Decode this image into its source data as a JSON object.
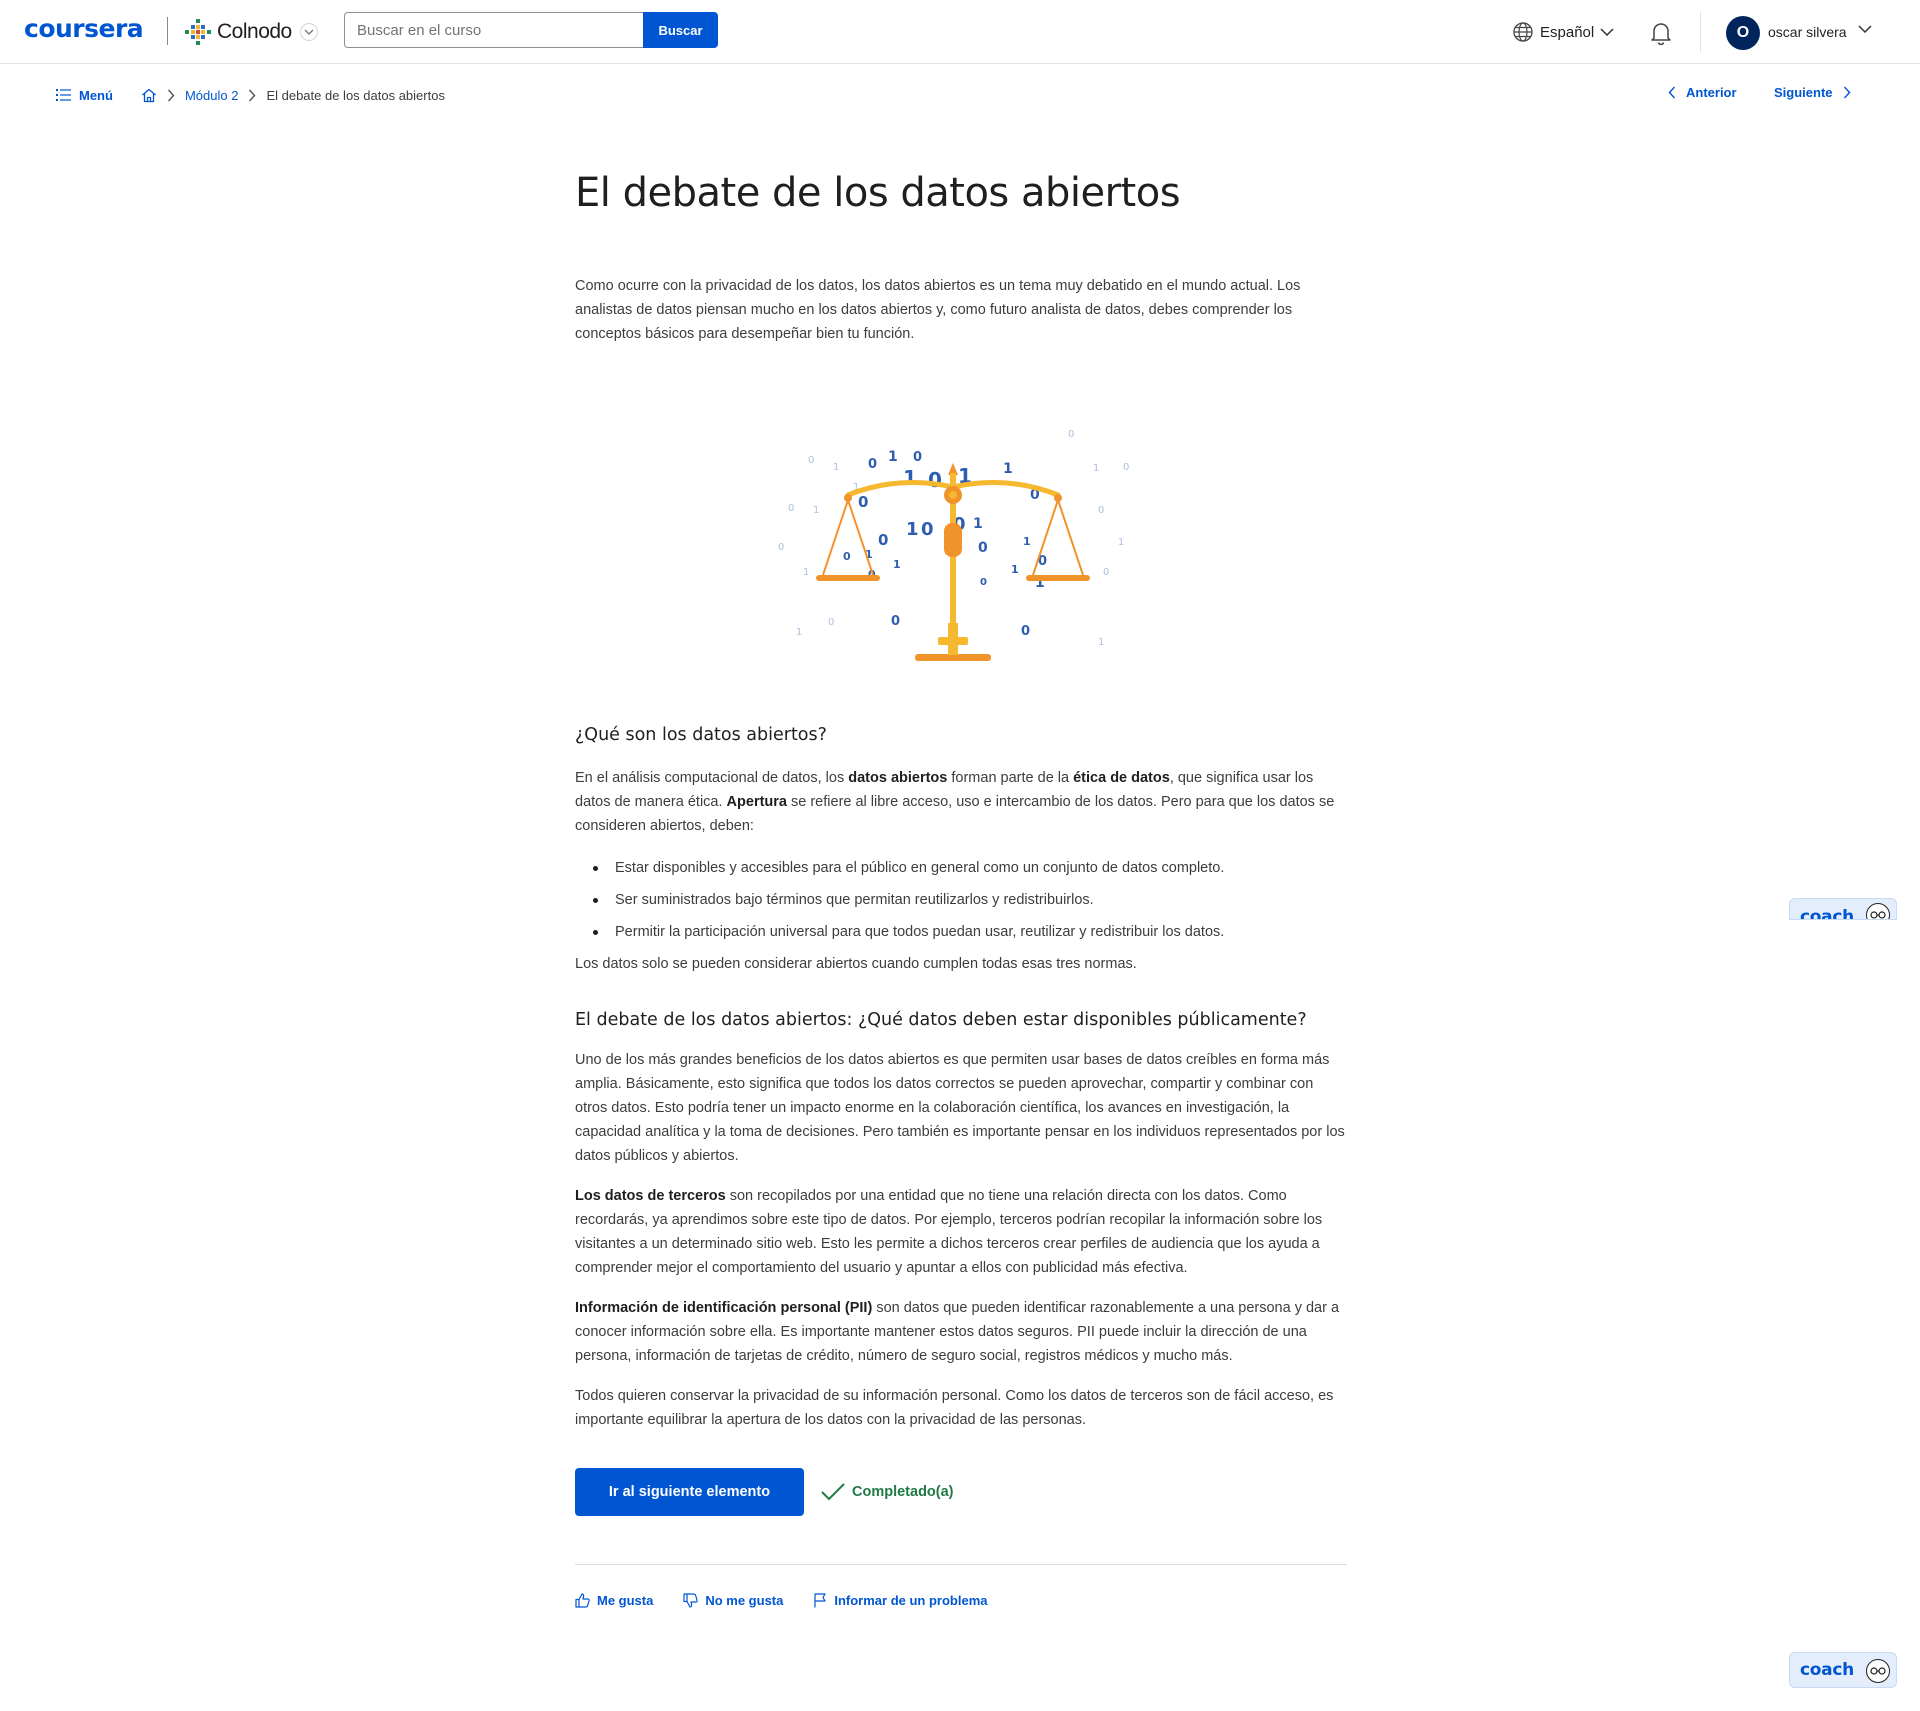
{
  "header": {
    "logo": "coursera",
    "partner": "Colnodo",
    "search_placeholder": "Buscar en el curso",
    "search_button": "Buscar",
    "language": "Español",
    "avatar_initial": "O",
    "user_name": "oscar silvera"
  },
  "breadcrumb": {
    "menu": "Menú",
    "module": "Módulo 2",
    "current": "El debate de los datos abiertos",
    "prev": "Anterior",
    "next": "Siguiente"
  },
  "article": {
    "title": "El debate de los datos abiertos",
    "intro": "Como ocurre con la privacidad de los datos, los datos abiertos es un tema muy debatido en el mundo actual. Los analistas de datos piensan mucho en los datos abiertos y, como futuro analista de datos, debes comprender los conceptos básicos para desempeñar bien tu función.",
    "section1": {
      "heading": "¿Qué son los datos abiertos?",
      "p1_a": "En el análisis computacional de datos, los ",
      "p1_b": "datos abiertos",
      "p1_c": " forman parte de la ",
      "p1_d": "ética de datos",
      "p1_e": ", que significa usar los datos de manera ética. ",
      "p1_f": "Apertura",
      "p1_g": " se refiere al libre acceso, uso e intercambio de los datos. Pero para que los datos se consideren abiertos, deben:",
      "bullets": [
        "Estar disponibles y accesibles para el público en general como un conjunto de datos completo.",
        "Ser suministrados bajo términos que permitan reutilizarlos y redistribuirlos.",
        "Permitir la participación universal para que todos puedan usar, reutilizar y redistribuir los datos."
      ],
      "p2": "Los datos solo se pueden considerar abiertos cuando cumplen todas esas tres normas."
    },
    "section2": {
      "heading": "El debate de los datos abiertos: ¿Qué datos deben estar disponibles públicamente?",
      "p1": "Uno de los más grandes beneficios de los datos abiertos es que permiten usar bases de datos creíbles en forma más amplia. Básicamente, esto significa que todos los datos correctos se pueden aprovechar, compartir y combinar con otros datos. Esto podría tener un impacto enorme en la colaboración científica, los avances en investigación, la capacidad analítica y la toma de decisiones. Pero también es importante pensar en los individuos representados por los datos públicos y abiertos.",
      "p2_bold": "Los datos de terceros",
      "p2_rest": " son recopilados por una entidad que no tiene una relación directa con los datos. Como recordarás, ya aprendimos sobre este tipo de datos. Por ejemplo, terceros podrían recopilar la información sobre los visitantes a un determinado sitio web. Esto les permite a dichos terceros crear perfiles de audiencia que los ayuda a comprender mejor el comportamiento del usuario y apuntar a ellos con publicidad más efectiva.",
      "p3_bold": "Información de identificación personal (PII)",
      "p3_rest": " son datos que pueden identificar razonablemente a una persona y dar a conocer información sobre ella. Es importante mantener estos datos seguros. PII puede incluir la dirección de una persona, información de tarjetas de crédito, número de seguro social, registros médicos y mucho más.",
      "p4": "Todos quieren conservar la privacidad de su información personal. Como los datos de terceros son de fácil acceso, es importante equilibrar la apertura de los datos con la privacidad de las personas."
    },
    "cta": "Ir al siguiente elemento",
    "completed": "Completado(a)",
    "like": "Me gusta",
    "dislike": "No me gusta",
    "report": "Informar de un problema"
  },
  "coach": {
    "label": "coach"
  },
  "colors": {
    "brand": "#0056d2",
    "success": "#1f7a45",
    "scale": "#f5b82e",
    "scale_dark": "#f0932b",
    "digits": "#2f5db0"
  }
}
